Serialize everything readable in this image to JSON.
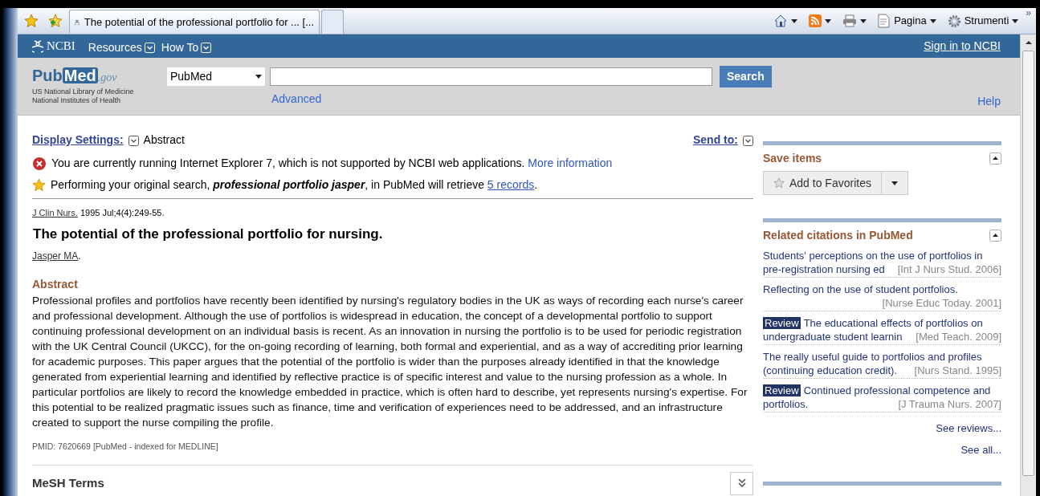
{
  "browser": {
    "tabs": [
      {
        "title": "The potential of the professional portfolio for ... [...",
        "selected": true
      },
      {
        "selected": false
      }
    ],
    "tools": [
      {
        "kind": "home"
      },
      {
        "kind": "feed"
      },
      {
        "kind": "print"
      },
      {
        "kind": "page",
        "label": "Pagina"
      },
      {
        "kind": "gear",
        "label": "Strumenti"
      }
    ],
    "more": "»"
  },
  "ncbi_bar": {
    "logo": "NCBI",
    "menus": [
      "Resources",
      "How To"
    ],
    "sign_in": "Sign in to NCBI"
  },
  "header": {
    "logo_a": "Pub",
    "logo_b": "Med",
    "logo_c": ".gov",
    "tag_lines": [
      "US National Library of Medicine",
      "National Institutes of Health"
    ],
    "database": "PubMed",
    "search_button": "Search",
    "advanced": "Advanced",
    "help": "Help"
  },
  "display": {
    "label": "Display Settings:",
    "value": "Abstract",
    "send_to": "Send to:"
  },
  "messages": [
    {
      "kind": "error",
      "text": "You are currently running Internet Explorer 7, which is not supported by NCBI web applications.",
      "link": "More information"
    },
    {
      "kind": "star",
      "text": "Performing your original search, **professional portfolio jasper**, in PubMed will retrieve",
      "link": "5 records",
      "after": "."
    }
  ],
  "article": {
    "journal": "J Clin Nurs.",
    "citation": "1995 Jul;4(4):249-55.",
    "title": "The potential of the professional portfolio for nursing.",
    "author": "Jasper MA",
    "author_after": ".",
    "abstract_heading": "Abstract",
    "abstract": "Professional profiles and portfolios have recently been identified by nursing's regulatory bodies in the UK as ways of recording each nurse's career and professional development. Although the use of portfolios is widespread in education, the concept of a developmental portfolio to support continuing professional development on an individual basis is recent. As an innovation in nursing the portfolio is to be used for periodic registration with the UK Central Council (UKCC), for the on-going recording of learning, both formal and experiential, and as a way of accrediting prior learning for academic purposes. This paper argues that the potential of the portfolio is wider than the purposes already identified in that the knowledge generated from experiential learning and identified by reflective practice is of specific interest and value to the nursing profession as a whole. In particular portfolios are likely to record the knowledge embedded in practice, which is often hard to describe, yet represents nursing's expertise. For this potential to be realized pragmatic issues such as finance, time and verification of experiences need to be addressed, and an infrastructure created to support the nurse compiling the profile.",
    "pmid": "PMID: 7620669 [PubMed - indexed for MEDLINE]",
    "mesh": "MeSH Terms"
  },
  "sidebar": {
    "save_title": "Save items",
    "favorites": "Add to Favorites",
    "related_title": "Related citations in PubMed",
    "related": [
      {
        "review": false,
        "title": "Students' perceptions on the use of portfolios in pre-registration nursing ed",
        "source": "[Int J Nurs Stud. 2006]"
      },
      {
        "review": false,
        "title": "Reflecting on the use of student portfolios.",
        "source": "[Nurse Educ Today. 2001]"
      },
      {
        "review": true,
        "badge": "Review",
        "title": "The educational effects of portfolios on undergraduate student learnin",
        "source": "[Med Teach. 2009]"
      },
      {
        "review": false,
        "title": "The really useful guide to portfolios and profiles (continuing education credit).",
        "source": "[Nurs Stand. 1995]"
      },
      {
        "review": true,
        "badge": "Review",
        "title": "Continued professional competence and portfolios.",
        "source": "[J Trauma Nurs. 2007]"
      }
    ],
    "see_reviews": "See reviews...",
    "see_all": "See all..."
  }
}
